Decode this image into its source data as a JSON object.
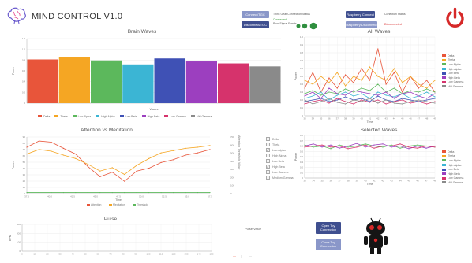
{
  "app": {
    "title": "MIND CONTROL V1.0",
    "brain_color": "#6a5acd"
  },
  "header": {
    "connect_label": "Connect/TGC",
    "disconnect_label": "Disconnect/TGC",
    "think_gear_status": "Think Gear Connection Status",
    "connected_label": "Connected",
    "post_signal_label": "Poor Signal Events",
    "rpi_connect_label": "Raspberry Connect",
    "rpi_disconnect_label": "Raspberry Disconnect",
    "connection_status_label": "Conection Status",
    "disconnected_label": "Disconnected",
    "button_color": "#3f4f8f",
    "button_light": "#8a97c9",
    "power_color": "#d62828"
  },
  "brain_waves": {
    "title": "Brain Waves",
    "xlabel": "Waves",
    "ylabel": "Power"
  },
  "attention_meditation": {
    "title": "Attention vs Meditation",
    "xlabel": "Time",
    "ylabel": "Power",
    "right_axis": "Attention Threshold Value",
    "legend": [
      "Attention",
      "Meditation",
      "Threshold"
    ]
  },
  "wave_checkboxes": {
    "items": [
      {
        "label": "Delta",
        "checked": false
      },
      {
        "label": "Theta",
        "checked": false
      },
      {
        "label": "Low Alpha",
        "checked": true
      },
      {
        "label": "High Alpha",
        "checked": false
      },
      {
        "label": "Low Beta",
        "checked": false
      },
      {
        "label": "High Beta",
        "checked": true
      },
      {
        "label": "Low Gamma",
        "checked": false
      },
      {
        "label": "Medium Gamma",
        "checked": false
      }
    ]
  },
  "all_waves": {
    "title": "All Waves",
    "xlabel": "Time",
    "ylabel": "Power",
    "legend": [
      "Delta",
      "Theta",
      "Low Alpha",
      "High Alpha",
      "Low Beta",
      "High Beta",
      "Low Gamma",
      "Mid Gamma"
    ]
  },
  "selected_waves": {
    "title": "Selected Waves",
    "xlabel": "Time",
    "ylabel": "Power",
    "legend": [
      "Delta",
      "Theta",
      "Low Alpha",
      "High Alpha",
      "Low Beta",
      "High Beta",
      "Low Gamma",
      "Mid Gamma"
    ]
  },
  "pulse": {
    "title": "Pulse",
    "ylabel": "BPM",
    "pulse_value_label": "Pulse Value"
  },
  "toy": {
    "open_label": "Open Toy Connection",
    "close_label": "Close Toy Connection"
  },
  "colors": {
    "delta": "#e8553a",
    "theta": "#f5a623",
    "low_alpha": "#5cb85c",
    "high_alpha": "#3bb5d4",
    "low_beta": "#3f51b5",
    "high_beta": "#9c3fbf",
    "low_gamma": "#d6336c",
    "mid_gamma": "#8a8a8a"
  },
  "chart_data": [
    {
      "type": "bar",
      "title": "Brain Waves",
      "xlabel": "Waves",
      "ylabel": "Power",
      "categories": [
        "Delta",
        "Theta",
        "Low Alpha",
        "High Alpha",
        "Low Beta",
        "High Beta",
        "Low Gamma",
        "Mid Gamma"
      ],
      "values": [
        0.88,
        0.92,
        0.86,
        0.78,
        0.9,
        0.84,
        0.8,
        0.74
      ],
      "ylim": [
        0,
        1.3
      ],
      "legend_position": "bottom"
    },
    {
      "type": "line",
      "title": "Attention vs Meditation",
      "xlabel": "Time",
      "ylabel": "Power",
      "x": [
        "37.5",
        "40.0",
        "42.5",
        "45.0",
        "47.5",
        "50.0",
        "52.5",
        "55.0",
        "57.5"
      ],
      "ylim": [
        0,
        100
      ],
      "series": [
        {
          "name": "Attention",
          "values": [
            82,
            93,
            91,
            80,
            70,
            48,
            30,
            38,
            22,
            40,
            45,
            55,
            60,
            68,
            72,
            78
          ]
        },
        {
          "name": "Meditation",
          "values": [
            70,
            78,
            75,
            68,
            62,
            52,
            40,
            46,
            34,
            50,
            62,
            72,
            76,
            80,
            82,
            85
          ]
        },
        {
          "name": "Threshold",
          "values": [
            2,
            2,
            2,
            2,
            2,
            2,
            2,
            2,
            2,
            2,
            2,
            2,
            2,
            2,
            2,
            2
          ]
        }
      ],
      "legend_position": "bottom"
    },
    {
      "type": "line",
      "title": "All Waves",
      "xlabel": "Time",
      "ylabel": "Power",
      "x": [
        "33",
        "34",
        "35",
        "36",
        "37",
        "38",
        "39",
        "40",
        "41",
        "42",
        "43",
        "44",
        "45",
        "46",
        "47",
        "48",
        "49"
      ],
      "ylim": [
        0,
        1
      ],
      "legend_position": "right",
      "series": [
        {
          "name": "Delta",
          "values": [
            0.35,
            0.55,
            0.3,
            0.48,
            0.35,
            0.52,
            0.42,
            0.6,
            0.45,
            0.85,
            0.4,
            0.55,
            0.3,
            0.5,
            0.35,
            0.45,
            0.3
          ]
        },
        {
          "name": "Theta",
          "values": [
            0.45,
            0.4,
            0.5,
            0.42,
            0.55,
            0.38,
            0.5,
            0.45,
            0.62,
            0.5,
            0.45,
            0.6,
            0.42,
            0.5,
            0.4,
            0.35,
            0.45
          ]
        },
        {
          "name": "Low Alpha",
          "values": [
            0.28,
            0.32,
            0.26,
            0.3,
            0.28,
            0.34,
            0.3,
            0.35,
            0.32,
            0.4,
            0.3,
            0.35,
            0.28,
            0.32,
            0.3,
            0.34,
            0.3
          ]
        },
        {
          "name": "High Alpha",
          "values": [
            0.22,
            0.25,
            0.3,
            0.2,
            0.26,
            0.3,
            0.25,
            0.28,
            0.22,
            0.3,
            0.26,
            0.24,
            0.28,
            0.22,
            0.25,
            0.3,
            0.24
          ]
        },
        {
          "name": "Low Beta",
          "values": [
            0.18,
            0.2,
            0.22,
            0.18,
            0.2,
            0.24,
            0.2,
            0.22,
            0.18,
            0.25,
            0.2,
            0.18,
            0.22,
            0.2,
            0.18,
            0.2,
            0.22
          ]
        },
        {
          "name": "High Beta",
          "values": [
            0.25,
            0.3,
            0.22,
            0.35,
            0.28,
            0.26,
            0.32,
            0.3,
            0.28,
            0.26,
            0.3,
            0.22,
            0.28,
            0.3,
            0.25,
            0.22,
            0.28
          ]
        },
        {
          "name": "Low Gamma",
          "values": [
            0.15,
            0.18,
            0.2,
            0.16,
            0.22,
            0.18,
            0.15,
            0.2,
            0.17,
            0.2,
            0.15,
            0.18,
            0.2,
            0.16,
            0.18,
            0.15,
            0.18
          ]
        },
        {
          "name": "Mid Gamma",
          "values": [
            0.2,
            0.15,
            0.18,
            0.22,
            0.17,
            0.15,
            0.2,
            0.18,
            0.22,
            0.16,
            0.2,
            0.16,
            0.15,
            0.18,
            0.2,
            0.18,
            0.16
          ]
        }
      ]
    },
    {
      "type": "line",
      "title": "Selected Waves",
      "xlabel": "Time",
      "ylabel": "Power",
      "x": [
        "33",
        "34",
        "35",
        "36",
        "37",
        "38",
        "39",
        "40",
        "41",
        "42",
        "43",
        "44",
        "45",
        "46",
        "47",
        "48"
      ],
      "ylim": [
        0,
        0.8
      ],
      "legend_position": "right",
      "series": [
        {
          "name": "Low Alpha",
          "values": [
            0.62,
            0.58,
            0.6,
            0.55,
            0.62,
            0.58,
            0.6,
            0.64,
            0.6,
            0.58,
            0.62,
            0.56,
            0.6,
            0.62,
            0.6,
            0.58
          ]
        },
        {
          "name": "High Beta",
          "values": [
            0.6,
            0.64,
            0.58,
            0.62,
            0.56,
            0.6,
            0.65,
            0.58,
            0.62,
            0.64,
            0.58,
            0.6,
            0.55,
            0.6,
            0.56,
            0.6
          ]
        },
        {
          "name": "Low Gamma",
          "values": [
            0.58,
            0.6,
            0.62,
            0.58,
            0.6,
            0.55,
            0.58,
            0.62,
            0.56,
            0.6,
            0.6,
            0.64,
            0.58,
            0.56,
            0.6,
            0.58
          ]
        }
      ]
    },
    {
      "type": "line",
      "title": "Pulse",
      "ylabel": "BPM",
      "ylim": [
        0,
        300
      ],
      "x": [
        "0",
        "10",
        "20",
        "30",
        "40",
        "50",
        "60",
        "70",
        "80",
        "90",
        "100",
        "110",
        "120",
        "130",
        "140",
        "150"
      ],
      "series": []
    }
  ]
}
